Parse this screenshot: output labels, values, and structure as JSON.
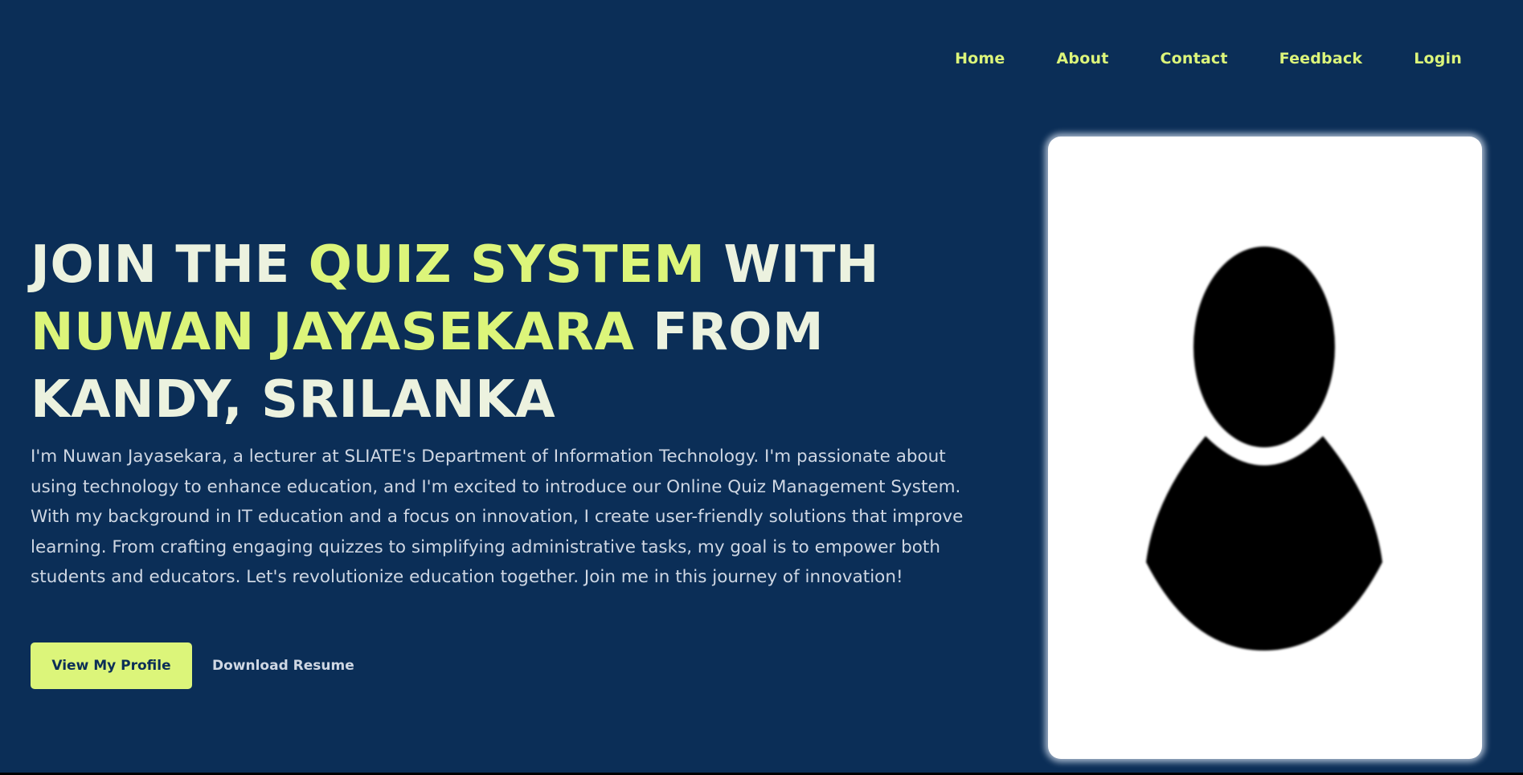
{
  "nav": {
    "items": [
      {
        "label": "Home"
      },
      {
        "label": "About"
      },
      {
        "label": "Contact"
      },
      {
        "label": "Feedback"
      },
      {
        "label": "Login"
      }
    ]
  },
  "hero": {
    "headline": {
      "part1": "JOIN THE ",
      "highlight1": "QUIZ SYSTEM",
      "part2": " WITH",
      "highlight2": "NUWAN JAYASEKARA",
      "part3": " FROM",
      "part4": "KANDY, SRILANKA"
    },
    "description": "I'm Nuwan Jayasekara, a lecturer at SLIATE's Department of Information Technology. I'm passionate about using technology to enhance education, and I'm excited to introduce our Online Quiz Management System. With my background in IT education and a focus on innovation, I create user-friendly solutions that improve learning. From crafting engaging quizzes to simplifying administrative tasks, my goal is to empower both students and educators. Let's revolutionize education together. Join me in this journey of innovation!",
    "primary_button": "View My Profile",
    "secondary_link": "Download Resume"
  },
  "profile_card": {
    "icon": "user-silhouette-icon"
  },
  "colors": {
    "background": "#0b2e57",
    "accent": "#dcf57a",
    "headline": "#ecf2df",
    "body_text": "#cfd7e3"
  }
}
